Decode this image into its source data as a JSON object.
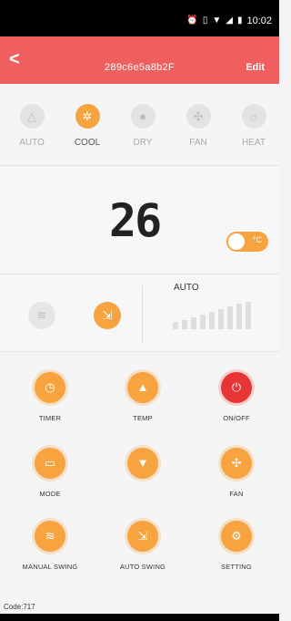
{
  "status_bar": {
    "icons": [
      "alarm-icon",
      "volte-icon",
      "wifi-icon",
      "signal-icon",
      "battery-icon"
    ],
    "time": "10:02"
  },
  "header": {
    "back_icon": "back-arrow-icon",
    "title": "289c6e5a8b2F",
    "edit_label": "Edit"
  },
  "modes": [
    {
      "label": "AUTO",
      "icon": "auto-icon",
      "active": false
    },
    {
      "label": "COOL",
      "icon": "snowflake-icon",
      "active": true
    },
    {
      "label": "DRY",
      "icon": "droplet-icon",
      "active": false
    },
    {
      "label": "FAN",
      "icon": "fan-icon",
      "active": false
    },
    {
      "label": "HEAT",
      "icon": "sun-icon",
      "active": false
    }
  ],
  "temperature": {
    "value": "26",
    "unit": "°C",
    "toggle_on": true
  },
  "fan": {
    "speed_label": "AUTO",
    "swing_off_icon": "manual-swing-icon",
    "swing_on_icon": "auto-swing-icon"
  },
  "controls": [
    {
      "label": "TIMER",
      "icon": "timer-icon"
    },
    {
      "label": "TEMP",
      "icon": "temp-up-icon"
    },
    {
      "label": "ON/OFF",
      "icon": "power-icon"
    },
    {
      "label": "MODE",
      "icon": "mode-icon"
    },
    {
      "label": "",
      "icon": "temp-down-icon"
    },
    {
      "label": "FAN",
      "icon": "fan-icon"
    },
    {
      "label": "MANUAL SWING",
      "icon": "manual-swing-icon"
    },
    {
      "label": "AUTO SWING",
      "icon": "auto-swing-icon"
    },
    {
      "label": "SETTING",
      "icon": "gear-icon"
    }
  ],
  "code": "Code:717",
  "colors": {
    "header": "#ef5f5f",
    "accent": "#f6a340",
    "power": "#e73535"
  }
}
